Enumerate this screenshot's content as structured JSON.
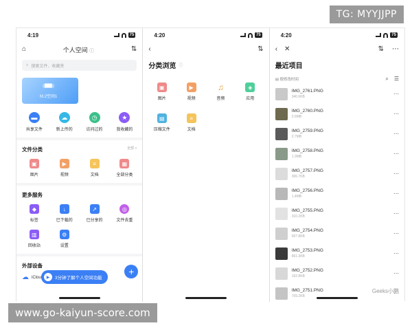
{
  "watermarks": {
    "top": "TG: MYYJJPP",
    "bottom": "www.go-kaiyun-score.com",
    "weibo": "Geeks小鹏"
  },
  "status": {
    "time1": "4:19",
    "time2": "4:20",
    "time3": "4:20",
    "battery": "75"
  },
  "phone1": {
    "title": "个人空间",
    "title_hint": "ⓘ",
    "search_placeholder": "搜索文件、收藏夹",
    "card_tag": "███",
    "card_caption": "M.2空间1",
    "quick": [
      {
        "label": "共享文件",
        "icon": "folder-icon",
        "color": "#3b7ff5"
      },
      {
        "label": "新上传的",
        "icon": "cloud-upload-icon",
        "color": "#35b8e6"
      },
      {
        "label": "访问过的",
        "icon": "clock-icon",
        "color": "#3cc08a"
      },
      {
        "label": "我收藏的",
        "icon": "star-icon",
        "color": "#8b5cf6"
      }
    ],
    "cat_title": "文件分类",
    "cat_more": "全部 >",
    "cats": [
      {
        "label": "图片",
        "icon": "image-icon",
        "color": "#f08a8a"
      },
      {
        "label": "视频",
        "icon": "video-icon",
        "color": "#f3a066"
      },
      {
        "label": "文档",
        "icon": "document-icon",
        "color": "#f5c45a"
      },
      {
        "label": "全部分类",
        "icon": "grid-icon",
        "color": "#f08a8a"
      }
    ],
    "svc_title": "更多服务",
    "svcs": [
      {
        "label": "标签",
        "icon": "tag-icon",
        "color": "#8b5cf6"
      },
      {
        "label": "已下载的",
        "icon": "download-icon",
        "color": "#3b7ff5"
      },
      {
        "label": "已分享的",
        "icon": "share-icon",
        "color": "#3b7ff5"
      },
      {
        "label": "文件去重",
        "icon": "dedupe-icon",
        "color": "#c061e8"
      },
      {
        "label": "回收站",
        "icon": "trash-icon",
        "color": "#8b5cf6"
      },
      {
        "label": "设置",
        "icon": "settings-icon",
        "color": "#3b7ff5"
      }
    ],
    "ext_title": "外部设备",
    "ext_item": "iCloud",
    "toast": "3分钟了解个人空间功能"
  },
  "phone2": {
    "title": "分类浏览",
    "title_hint": "ⓘ",
    "cats": [
      {
        "label": "图片",
        "icon": "image-icon",
        "color": "#f08a8a"
      },
      {
        "label": "视频",
        "icon": "video-icon",
        "color": "#f3a066"
      },
      {
        "label": "音频",
        "icon": "music-icon",
        "color": "#e8a23c"
      },
      {
        "label": "应用",
        "icon": "app-icon",
        "color": "#4fcf9a"
      },
      {
        "label": "压缩文件",
        "icon": "zip-icon",
        "color": "#4fb3e0"
      },
      {
        "label": "文档",
        "icon": "document-icon",
        "color": "#f5c45a"
      }
    ]
  },
  "phone3": {
    "title": "最近项目",
    "sort_label": "按修改时间",
    "files": [
      {
        "name": "IMG_2761.PNG",
        "size": "340.6KB",
        "thumb": "#c9c9c9"
      },
      {
        "name": "IMG_2760.PNG",
        "size": "2.6MB",
        "thumb": "#6e6a4f"
      },
      {
        "name": "IMG_2759.PNG",
        "size": "2.7MB",
        "thumb": "#5a5a5a"
      },
      {
        "name": "IMG_2758.PNG",
        "size": "1.3MB",
        "thumb": "#8a9a8a"
      },
      {
        "name": "IMG_2757.PNG",
        "size": "306.7KB",
        "thumb": "#dcdcdc"
      },
      {
        "name": "IMG_2756.PNG",
        "size": "1.4MB",
        "thumb": "#b8b8b8"
      },
      {
        "name": "IMG_2755.PNG",
        "size": "310.2KB",
        "thumb": "#e2e2e2"
      },
      {
        "name": "IMG_2754.PNG",
        "size": "507.8KB",
        "thumb": "#cfcfcf"
      },
      {
        "name": "IMG_2753.PNG",
        "size": "861.3KB",
        "thumb": "#3a3a3a"
      },
      {
        "name": "IMG_2752.PNG",
        "size": "152.8KB",
        "thumb": "#d8d8d8"
      },
      {
        "name": "IMG_2751.PNG",
        "size": "709.2KB",
        "thumb": "#c4c4c4"
      }
    ]
  }
}
